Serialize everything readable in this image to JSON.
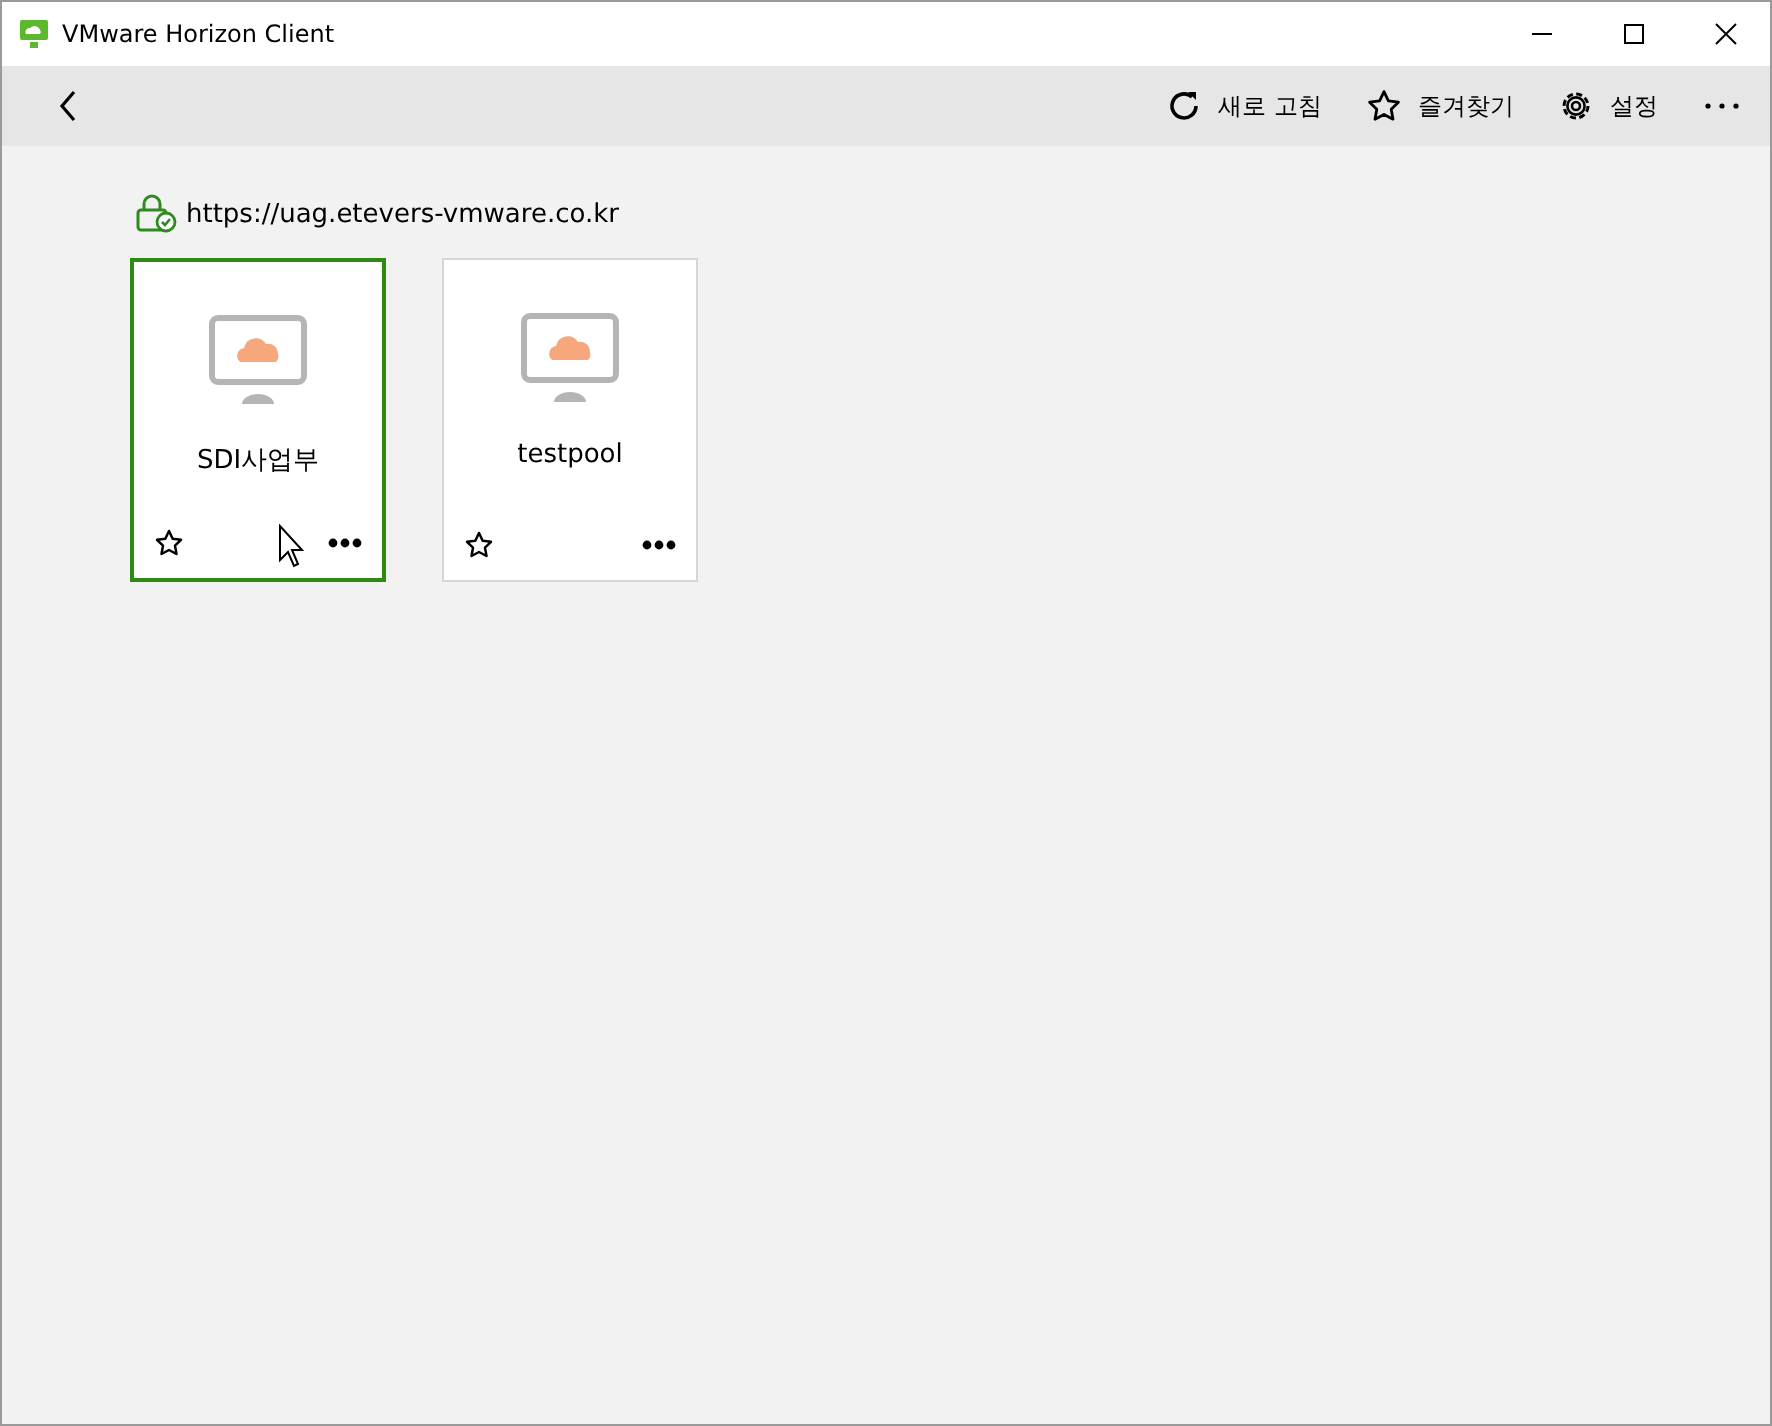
{
  "window": {
    "title": "VMware Horizon Client"
  },
  "toolbar": {
    "actions": [
      {
        "kind": "refresh",
        "label": "새로 고침"
      },
      {
        "kind": "favorites",
        "label": "즐겨찾기"
      },
      {
        "kind": "settings",
        "label": "설정"
      }
    ]
  },
  "server": {
    "url": "https://uag.etevers-vmware.co.kr"
  },
  "pools": [
    {
      "name": "SDI사업부",
      "selected": true,
      "favorite": false
    },
    {
      "name": "testpool",
      "selected": false,
      "favorite": false
    }
  ]
}
